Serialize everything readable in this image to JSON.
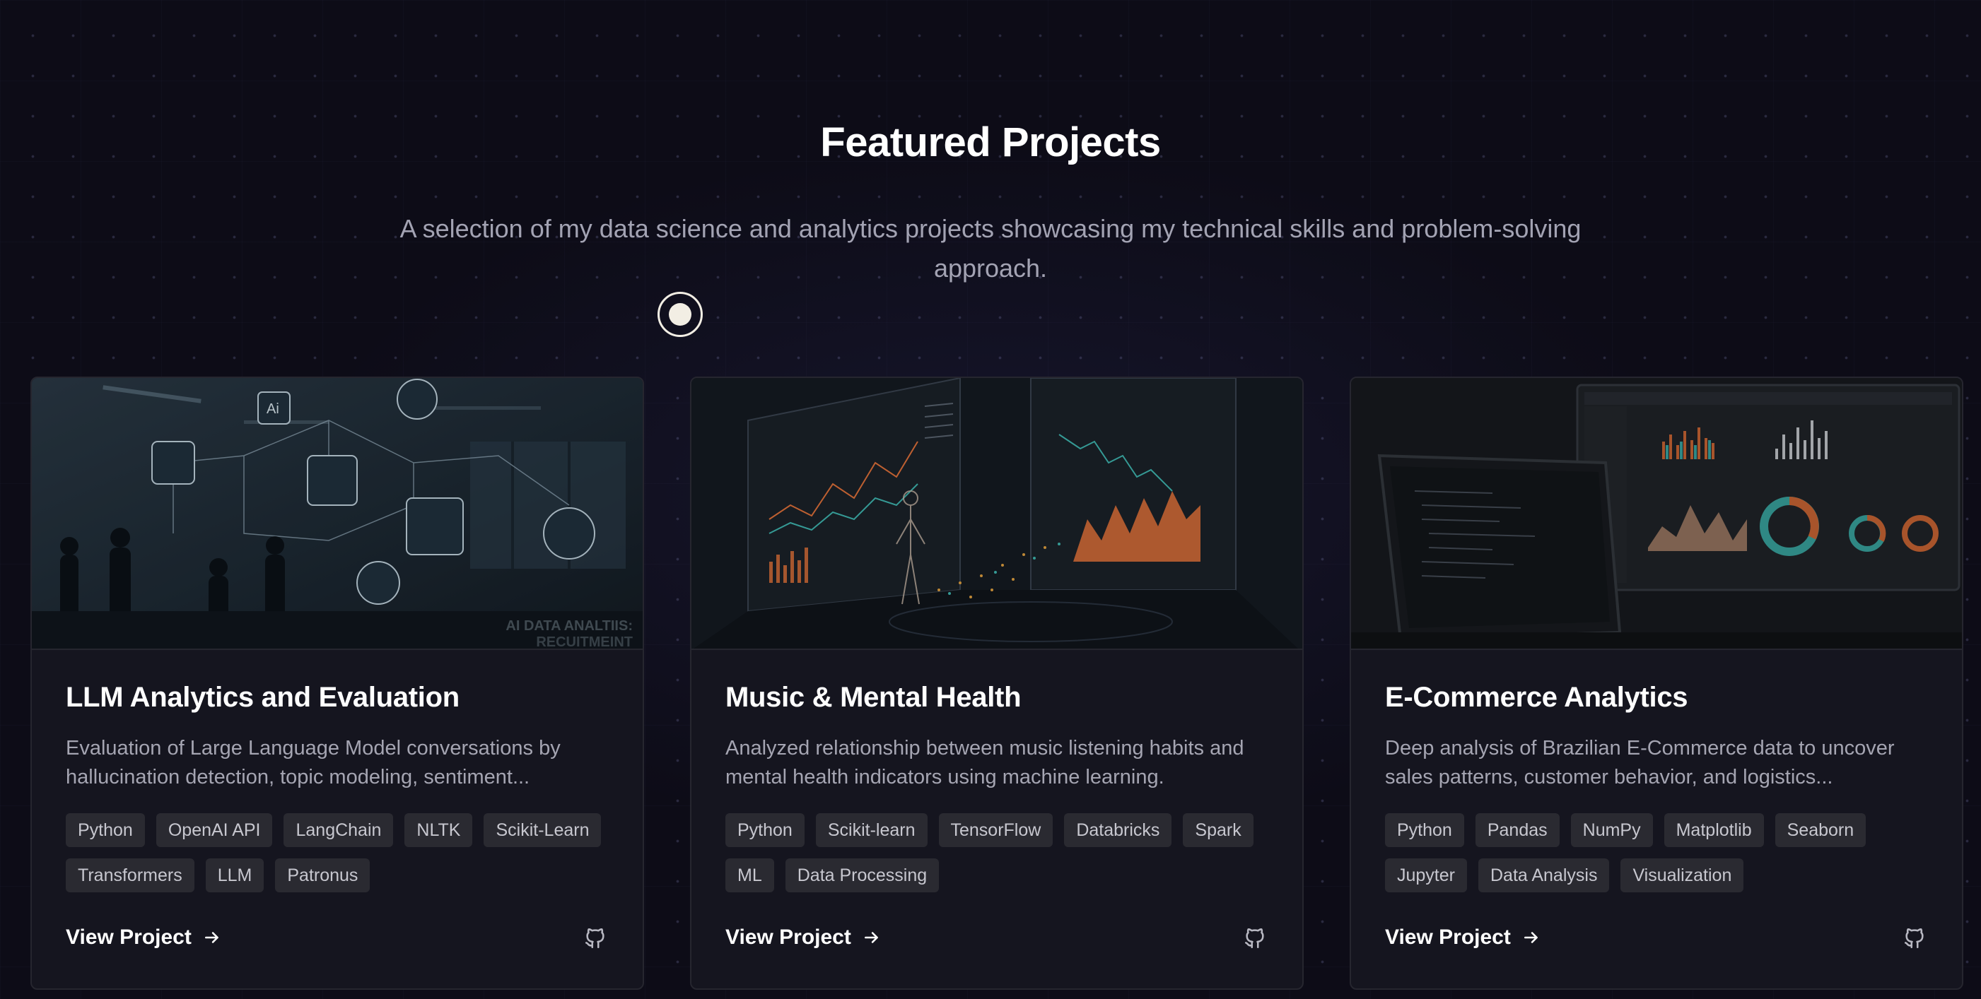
{
  "section": {
    "title": "Featured Projects",
    "subtitle": "A selection of my data science and analytics projects showcasing my technical skills and problem-solving approach."
  },
  "projects": [
    {
      "title": "LLM Analytics and Evaluation",
      "description": "Evaluation of Large Language Model conversations by hallucination detection, topic modeling, sentiment...",
      "tags": [
        "Python",
        "OpenAI API",
        "LangChain",
        "NLTK",
        "Scikit-Learn",
        "Transformers",
        "LLM",
        "Patronus"
      ],
      "image_text": [
        "Ai",
        "AI DATA ANALTIIS:",
        "RECUITMEINT"
      ],
      "link_label": "View Project",
      "link_icon": "arrow-right-icon",
      "repo_icon": "github-icon"
    },
    {
      "title": "Music & Mental Health",
      "description": "Analyzed relationship between music listening habits and mental health indicators using machine learning.",
      "tags": [
        "Python",
        "Scikit-learn",
        "TensorFlow",
        "Databricks",
        "Spark",
        "ML",
        "Data Processing"
      ],
      "link_label": "View Project",
      "link_icon": "arrow-right-icon",
      "repo_icon": "github-icon"
    },
    {
      "title": "E-Commerce Analytics",
      "description": "Deep analysis of Brazilian E-Commerce data to uncover sales patterns, customer behavior, and logistics...",
      "tags": [
        "Python",
        "Pandas",
        "NumPy",
        "Matplotlib",
        "Seaborn",
        "Jupyter",
        "Data Analysis",
        "Visualization"
      ],
      "link_label": "View Project",
      "link_icon": "arrow-right-icon",
      "repo_icon": "github-icon"
    }
  ],
  "colors": {
    "background": "#0d0c17",
    "card": "#15151f",
    "tag": "#2a2a31",
    "accent_orange": "#e0713a",
    "accent_teal": "#3fb6b0"
  }
}
